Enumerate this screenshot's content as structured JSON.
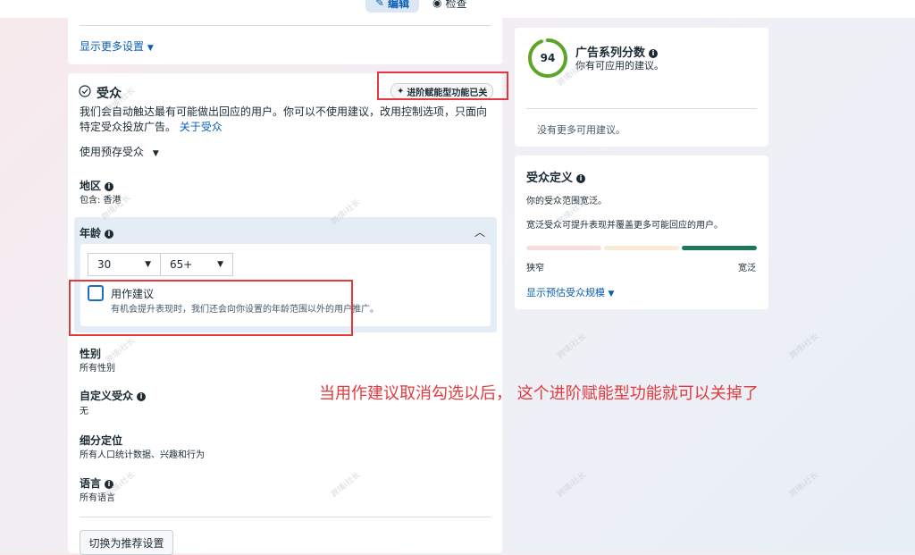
{
  "top_tabs": {
    "edit": "编辑",
    "review": "检查"
  },
  "left_top": {
    "show_more": "显示更多设置"
  },
  "audience": {
    "title": "受众",
    "advantage_pill": "进阶赋能型功能已关",
    "description": "我们会自动触达最有可能做出回应的用户。你可以不使用建议，改用控制选项，只面向特定受众投放广告。",
    "about_link": "关于受众",
    "use_saved": "使用预存受众",
    "region": {
      "label": "地区",
      "value": "包含: 香港"
    },
    "age": {
      "label": "年龄",
      "min": "30",
      "max": "65+",
      "suggestion_label": "用作建议",
      "suggestion_desc": "有机会提升表现时，我们还会向你设置的年龄范围以外的用户推广。"
    },
    "gender": {
      "label": "性别",
      "value": "所有性别"
    },
    "custom_audience": {
      "label": "自定义受众",
      "value": "无"
    },
    "detailed_targeting": {
      "label": "细分定位",
      "value": "所有人口统计数据、兴趣和行为"
    },
    "language": {
      "label": "语言",
      "value": "所有语言"
    },
    "switch_button": "切换为推荐设置"
  },
  "score_card": {
    "score": "94",
    "score_fraction": 0.94,
    "title": "广告系列分数",
    "subtitle": "你有可应用的建议。",
    "no_more": "没有更多可用建议。",
    "accent": "#5ba626"
  },
  "definition_card": {
    "title": "受众定义",
    "line1": "你的受众范围宽泛。",
    "line2": "宽泛受众可提升表现并覆盖更多可能回应的用户。",
    "narrow": "狭窄",
    "broad": "宽泛",
    "show_estimate": "显示预估受众规模",
    "colors": {
      "narrow": "#f6dede",
      "middle": "#f8ecd5",
      "broad": "#1b7a5a"
    }
  },
  "annotation": "当用作建议取消勾选以后，  这个进阶赋能型功能就可以关掉了",
  "watermark": "跨境i社长"
}
